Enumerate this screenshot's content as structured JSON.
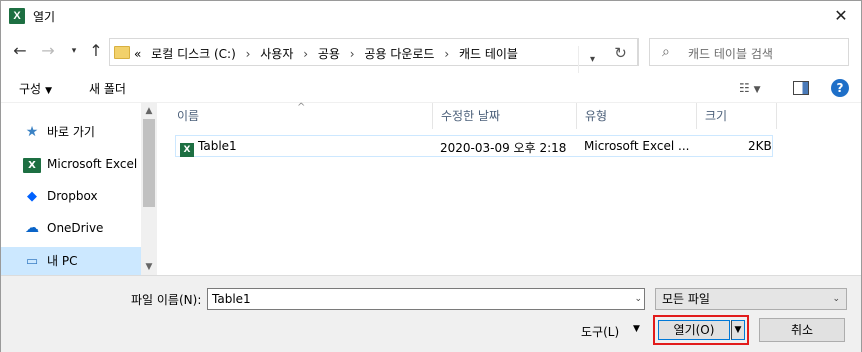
{
  "window": {
    "title": "열기",
    "app_icon_letter": "X"
  },
  "nav": {
    "back_icon": "back-arrow-icon",
    "forward_icon": "forward-arrow-icon",
    "history_icon": "chevron-down-icon",
    "up_icon": "up-arrow-icon"
  },
  "address": {
    "overflow": "«",
    "crumbs": [
      "로컬 디스크 (C:)",
      "사용자",
      "공용",
      "공용 다운로드",
      "캐드 테이블"
    ]
  },
  "search": {
    "placeholder": "캐드 테이블 검색"
  },
  "toolbar": {
    "organize_label": "구성",
    "new_folder_label": "새 폴더"
  },
  "navpane": {
    "items": [
      {
        "label": "바로 가기",
        "icon": "star-icon"
      },
      {
        "label": "Microsoft Excel",
        "icon": "excel-icon"
      },
      {
        "label": "Dropbox",
        "icon": "dropbox-icon"
      },
      {
        "label": "OneDrive",
        "icon": "cloud-icon"
      },
      {
        "label": "내 PC",
        "icon": "computer-icon"
      }
    ]
  },
  "columns": [
    "이름",
    "수정한 날짜",
    "유형",
    "크기"
  ],
  "files": [
    {
      "name": "Table1",
      "modified": "2020-03-09 오후 2:18",
      "type": "Microsoft Excel ...",
      "size": "2KB"
    }
  ],
  "bottom": {
    "filename_label": "파일 이름(N):",
    "filename_value": "Table1",
    "filter_value": "모든 파일",
    "tools_label": "도구(L)",
    "open_label": "열기(O)",
    "cancel_label": "취소"
  },
  "colors": {
    "accent": "#0078d7",
    "selection": "#cce8ff",
    "highlight_border": "#e21b1b",
    "excel_green": "#1d6f42"
  }
}
